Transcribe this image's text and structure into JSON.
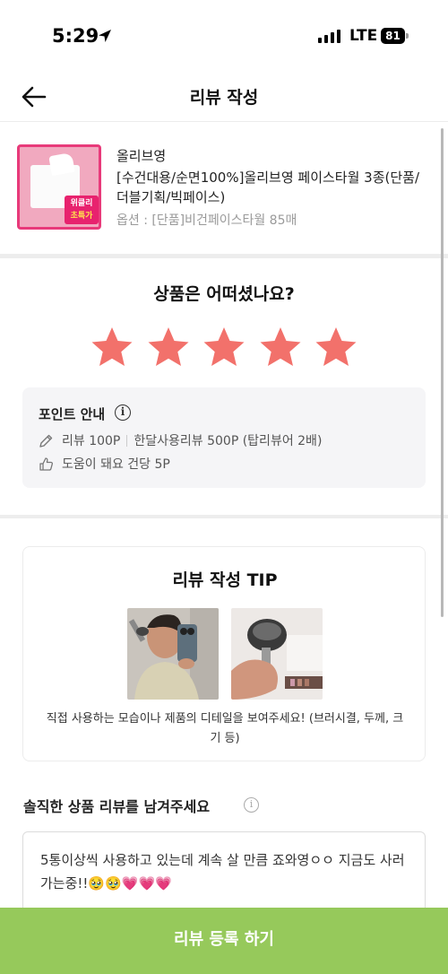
{
  "status_bar": {
    "time": "5:29",
    "network": "LTE",
    "battery": "81"
  },
  "header": {
    "title": "리뷰 작성"
  },
  "product": {
    "brand": "올리브영",
    "name": "[수건대용/순면100%]올리브영 페이스타월 3종(단품/더블기획/빅페이스)",
    "option": "옵션 : [단품]비건페이스타월 85매",
    "thumb_badge_line1": "위클리",
    "thumb_badge_line2": "초특가"
  },
  "rating": {
    "question": "상품은 어떠셨나요?",
    "stars": 5,
    "star_color": "#f2716b"
  },
  "point_info": {
    "title": "포인트 안내",
    "review_reward": "리뷰 100P",
    "monthly_reward": "한달사용리뷰 500P (탑리뷰어 2배)",
    "helpful_reward": "도움이 돼요 건당 5P"
  },
  "tip": {
    "title": "리뷰 작성 TIP",
    "text": "직접 사용하는 모습이나 제품의 디테일을 보여주세요! (브러시결, 두께, 크기 등)"
  },
  "review": {
    "label": "솔직한 상품 리뷰를 남겨주세요",
    "content": "5통이상씩 사용하고 있는데 계속 살 만큼 죠와영ㅇㅇ 지금도 사러가는중!!🥹🥹💗💗💗"
  },
  "submit": {
    "label": "리뷰 등록 하기",
    "color": "#96c95b"
  }
}
